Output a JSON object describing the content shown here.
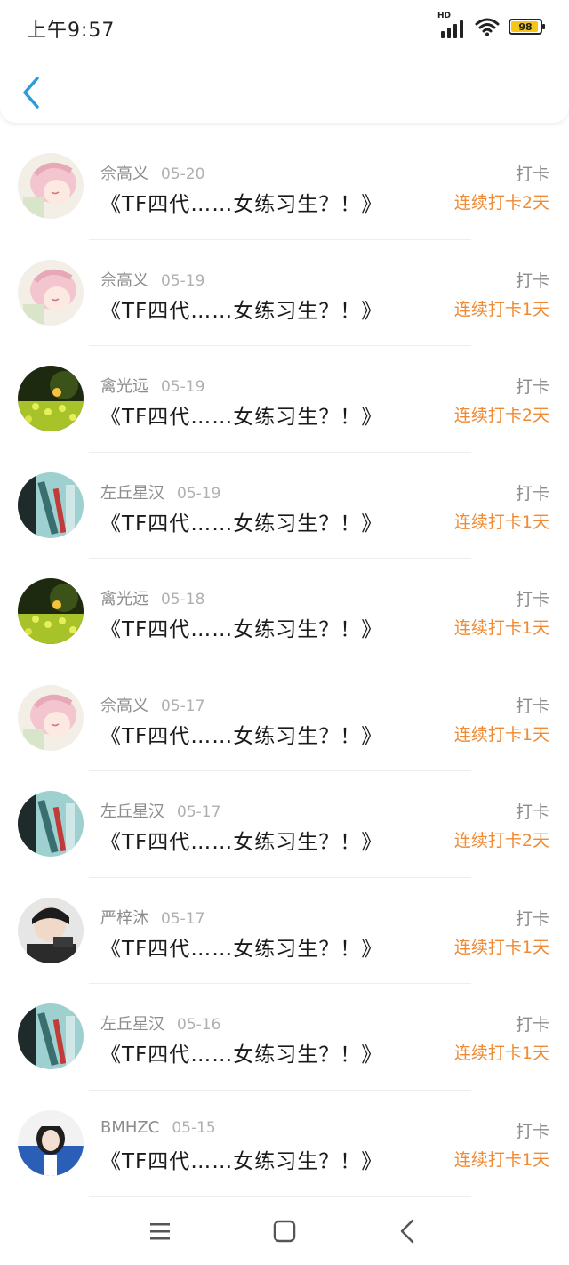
{
  "status_bar": {
    "time": "上午9:57",
    "signal_label": "HD",
    "battery": "98"
  },
  "header": {
    "back_icon": "chevron-left-icon",
    "accent_color": "#2a9bde"
  },
  "colors": {
    "streak": "#f08a34",
    "meta": "#8c8c8c"
  },
  "records": [
    {
      "user": "佘高义",
      "date": "05-20",
      "title": "《TF四代……女练习生？！》",
      "action": "打卡",
      "streak": "连续打卡2天",
      "avatar": "anime"
    },
    {
      "user": "佘高义",
      "date": "05-19",
      "title": "《TF四代……女练习生？！》",
      "action": "打卡",
      "streak": "连续打卡1天",
      "avatar": "anime"
    },
    {
      "user": "禽光远",
      "date": "05-19",
      "title": "《TF四代……女练习生？！》",
      "action": "打卡",
      "streak": "连续打卡2天",
      "avatar": "flowers"
    },
    {
      "user": "左丘星汉",
      "date": "05-19",
      "title": "《TF四代……女练习生？！》",
      "action": "打卡",
      "streak": "连续打卡1天",
      "avatar": "teal"
    },
    {
      "user": "禽光远",
      "date": "05-18",
      "title": "《TF四代……女练习生？！》",
      "action": "打卡",
      "streak": "连续打卡1天",
      "avatar": "flowers"
    },
    {
      "user": "佘高义",
      "date": "05-17",
      "title": "《TF四代……女练习生？！》",
      "action": "打卡",
      "streak": "连续打卡1天",
      "avatar": "anime"
    },
    {
      "user": "左丘星汉",
      "date": "05-17",
      "title": "《TF四代……女练习生？！》",
      "action": "打卡",
      "streak": "连续打卡2天",
      "avatar": "teal"
    },
    {
      "user": "严梓沐",
      "date": "05-17",
      "title": "《TF四代……女练习生？！》",
      "action": "打卡",
      "streak": "连续打卡1天",
      "avatar": "person"
    },
    {
      "user": "左丘星汉",
      "date": "05-16",
      "title": "《TF四代……女练习生？！》",
      "action": "打卡",
      "streak": "连续打卡1天",
      "avatar": "teal"
    },
    {
      "user": "BMHZC",
      "date": "05-15",
      "title": "《TF四代……女练习生？！》",
      "action": "打卡",
      "streak": "连续打卡1天",
      "avatar": "blue"
    }
  ],
  "navbar": {
    "menu_icon": "menu-icon",
    "home_icon": "home-square-icon",
    "back_icon": "back-triangle-icon"
  }
}
